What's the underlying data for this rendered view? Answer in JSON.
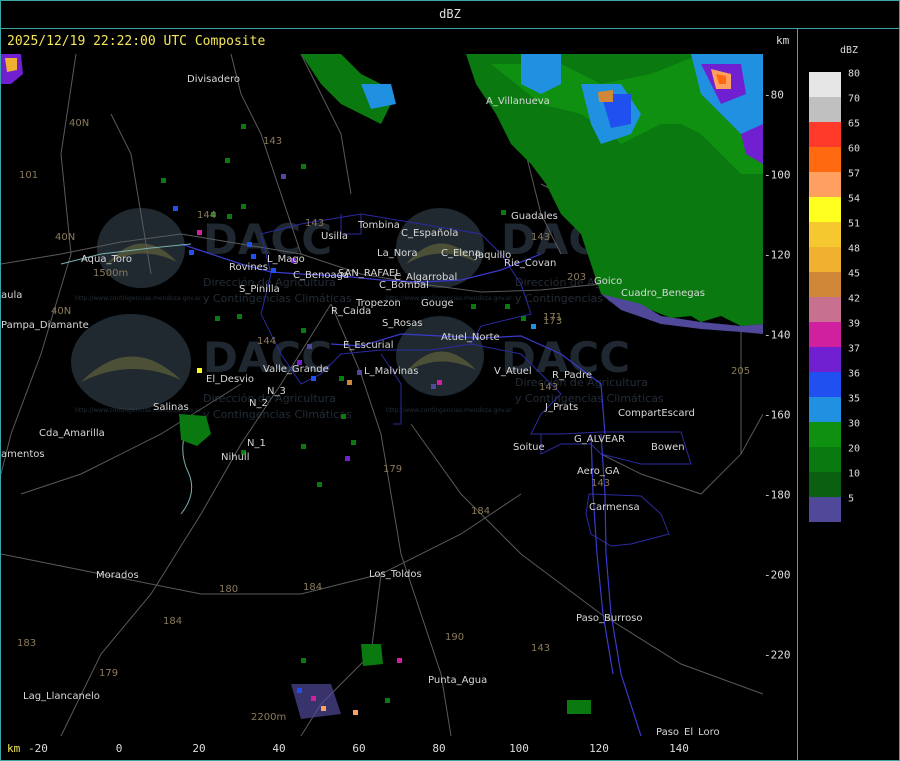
{
  "header": {
    "title": "dBZ"
  },
  "map": {
    "timestamp": "2025/12/19 22:22:00 UTC Composite",
    "unit_top": "km",
    "unit_bottom": "km",
    "x_ticks": [
      "-20",
      "0",
      "20",
      "40",
      "60",
      "80",
      "100",
      "120",
      "140"
    ],
    "y_ticks": [
      "-80",
      "-100",
      "-120",
      "-140",
      "-160",
      "-180",
      "-200",
      "-220"
    ],
    "places": [
      "Divisadero",
      "A_Villanueva",
      "Guadales",
      "Tombina",
      "Usilla",
      "C_Española",
      "La_Nora",
      "C_Elena",
      "Jaquillo",
      "Rie_Covan",
      "SAN_RAFAEL",
      "C_Benoaga",
      "Rovines",
      "L_Mago",
      "C_Algarrobal",
      "C_Bombal",
      "S_Pinilla",
      "R_Caida",
      "Tropezon",
      "Gouge",
      "S_Rosas",
      "Goico",
      "Cuadro_Benegas",
      "Atuel_Norte",
      "E_Escurial",
      "Valle_Grande",
      "El_Desvio",
      "L_Malvinas",
      "V_Atuel",
      "R_Padre",
      "J_Prats",
      "CompartEscard",
      "G_ALVEAR",
      "Bowen",
      "Soitue",
      "Aero_GA",
      "Carmensa",
      "Salinas",
      "N_2",
      "N_3",
      "N_1",
      "Nihuil",
      "Cda_Amarilla",
      "amentos",
      "Aqua_Toro",
      "aula",
      "Pampa_Diamante",
      "Los_Toldos",
      "Morados",
      "Paso_Burroso",
      "Punta_Agua",
      "Lag_Llancanelo",
      "Paso_El_Loro"
    ],
    "routes": [
      "40N",
      "101",
      "40N",
      "40N",
      "143",
      "143",
      "143",
      "144",
      "144",
      "143",
      "173",
      "171",
      "203",
      "205",
      "179",
      "184",
      "180",
      "184",
      "184",
      "183",
      "179",
      "190",
      "143",
      "143"
    ],
    "elevations": [
      "1500m",
      "2200m"
    ],
    "watermark": {
      "logo_text": "DACC",
      "line1": "Dirección de Agricultura",
      "line2": "y Contingencias Climáticas",
      "url": "http://www.contingencias.mendoza.gov.ar"
    }
  },
  "legend": {
    "unit": "dBZ",
    "levels": [
      {
        "label": "80",
        "color": "#e6e6e6"
      },
      {
        "label": "70",
        "color": "#c0c0c0"
      },
      {
        "label": "65",
        "color": "#ff3a2a"
      },
      {
        "label": "60",
        "color": "#ff6a10"
      },
      {
        "label": "57",
        "color": "#ffa060"
      },
      {
        "label": "54",
        "color": "#ffff20"
      },
      {
        "label": "51",
        "color": "#f5c830"
      },
      {
        "label": "48",
        "color": "#f0b030"
      },
      {
        "label": "45",
        "color": "#d08838"
      },
      {
        "label": "42",
        "color": "#c87090"
      },
      {
        "label": "39",
        "color": "#d020a0"
      },
      {
        "label": "37",
        "color": "#7020d0"
      },
      {
        "label": "36",
        "color": "#2050f0"
      },
      {
        "label": "35",
        "color": "#2090e0"
      },
      {
        "label": "30",
        "color": "#109010"
      },
      {
        "label": "20",
        "color": "#0a7a10"
      },
      {
        "label": "10",
        "color": "#0a6010"
      },
      {
        "label": "5",
        "color": "#504898"
      }
    ]
  }
}
